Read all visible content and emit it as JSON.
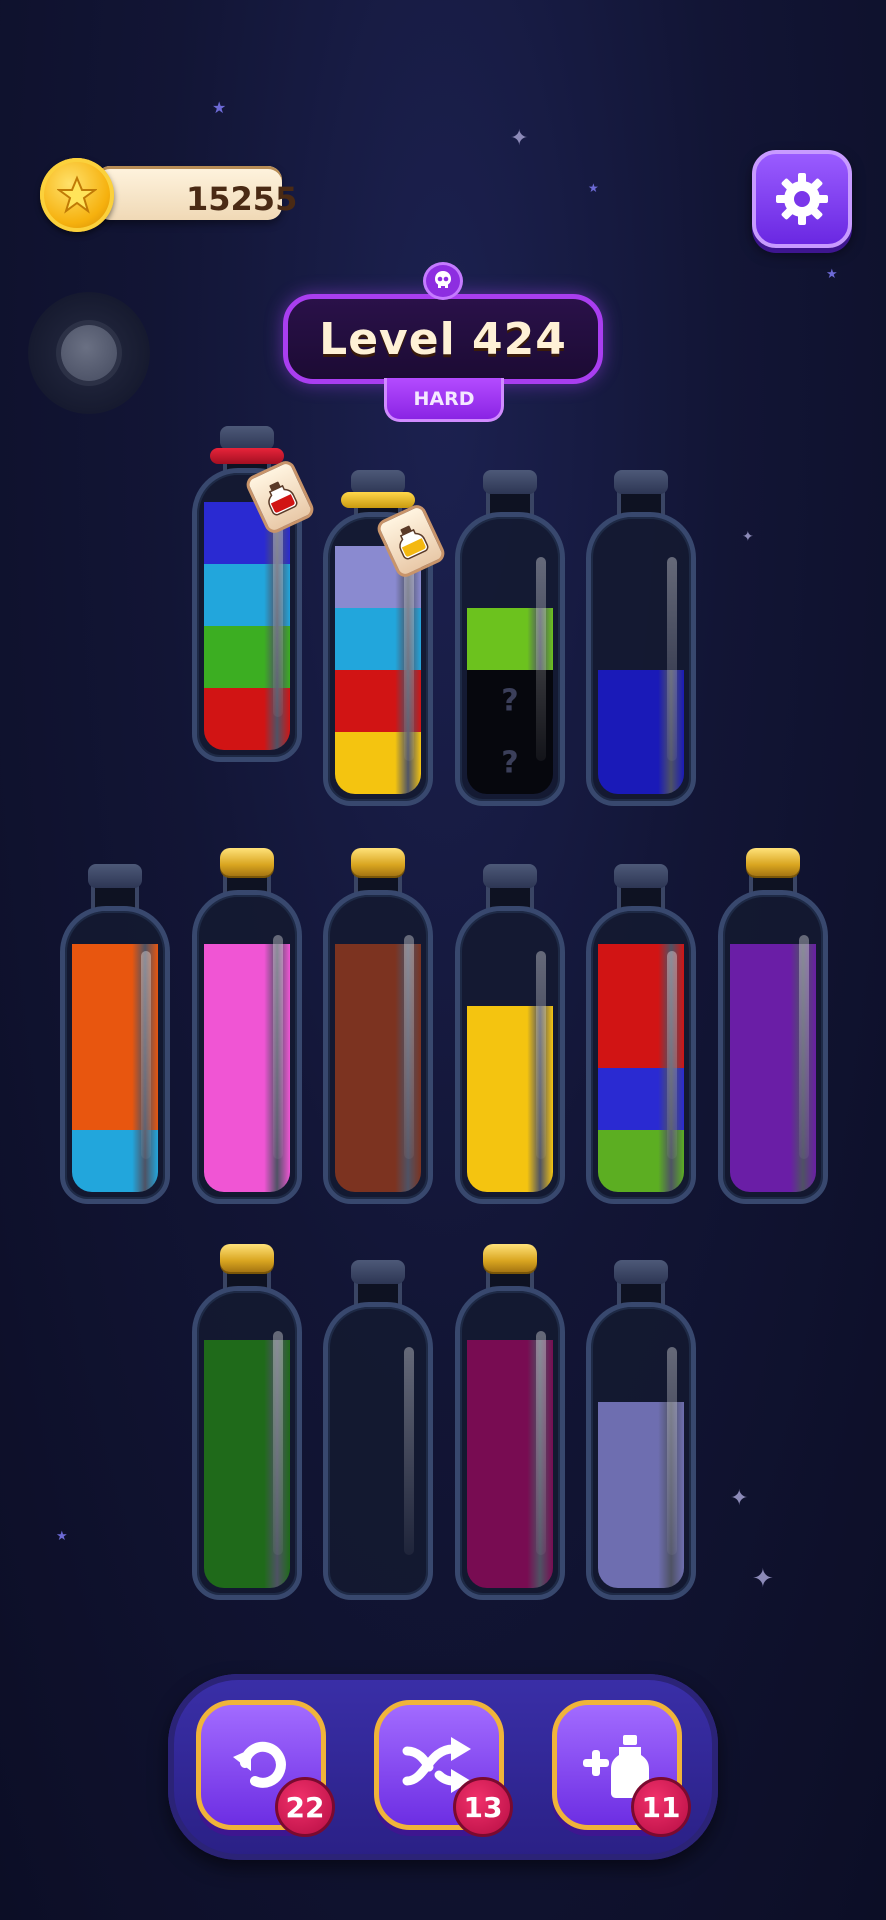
{
  "header": {
    "coins": "15255",
    "coin_icon": "star-coin-icon",
    "settings_icon": "gear-icon"
  },
  "level": {
    "title": "Level 424",
    "difficulty": "HARD",
    "difficulty_icon": "skull-icon"
  },
  "bottles": [
    {
      "id": 1,
      "row": 1,
      "closed": false,
      "tied": true,
      "tag": "red-potion",
      "layers": [
        "#d11414",
        "#3cae22",
        "#22a6dc",
        "#2a2ad2"
      ]
    },
    {
      "id": 2,
      "row": 1,
      "closed": false,
      "tied": true,
      "tag": "yellow-potion",
      "layers": [
        "#f4c410",
        "#d11414",
        "#22a6dc",
        "#8a8ad0"
      ]
    },
    {
      "id": 3,
      "row": 1,
      "closed": false,
      "tied": false,
      "layers": [
        "hidden",
        "hidden",
        "#6cc21e"
      ],
      "hidden_mark": "?"
    },
    {
      "id": 4,
      "row": 1,
      "closed": false,
      "tied": false,
      "layers": [
        "#1a1ab8",
        "#1a1ab8"
      ]
    },
    {
      "id": 5,
      "row": 2,
      "closed": false,
      "tied": false,
      "layers": [
        "#22a6dc",
        "#e8560f",
        "#e8560f",
        "#e8560f"
      ]
    },
    {
      "id": 6,
      "row": 2,
      "closed": true,
      "tied": false,
      "layers": [
        "#f055d4",
        "#f055d4",
        "#f055d4",
        "#f055d4"
      ]
    },
    {
      "id": 7,
      "row": 2,
      "closed": true,
      "tied": false,
      "layers": [
        "#7c3320",
        "#7c3320",
        "#7c3320",
        "#7c3320"
      ]
    },
    {
      "id": 8,
      "row": 2,
      "closed": false,
      "tied": false,
      "layers": [
        "#f4c410",
        "#f4c410",
        "#f4c410"
      ]
    },
    {
      "id": 9,
      "row": 2,
      "closed": false,
      "tied": false,
      "layers": [
        "#5cae22",
        "#2a2ad2",
        "#d11414",
        "#d11414"
      ]
    },
    {
      "id": 10,
      "row": 2,
      "closed": true,
      "tied": false,
      "layers": [
        "#6a1ea6",
        "#6a1ea6",
        "#6a1ea6",
        "#6a1ea6"
      ]
    },
    {
      "id": 11,
      "row": 3,
      "closed": true,
      "tied": false,
      "layers": [
        "#1f6a1a",
        "#1f6a1a",
        "#1f6a1a",
        "#1f6a1a"
      ]
    },
    {
      "id": 12,
      "row": 3,
      "closed": false,
      "tied": false,
      "layers": []
    },
    {
      "id": 13,
      "row": 3,
      "closed": true,
      "tied": false,
      "layers": [
        "#780c52",
        "#780c52",
        "#780c52",
        "#780c52"
      ]
    },
    {
      "id": 14,
      "row": 3,
      "closed": false,
      "tied": false,
      "layers": [
        "#6e6eb0",
        "#6e6eb0",
        "#6e6eb0"
      ]
    }
  ],
  "actions": {
    "undo": {
      "icon": "undo-icon",
      "count": "22"
    },
    "shuffle": {
      "icon": "shuffle-icon",
      "count": "13"
    },
    "add_bottle": {
      "icon": "add-bottle-icon",
      "count": "11"
    }
  }
}
